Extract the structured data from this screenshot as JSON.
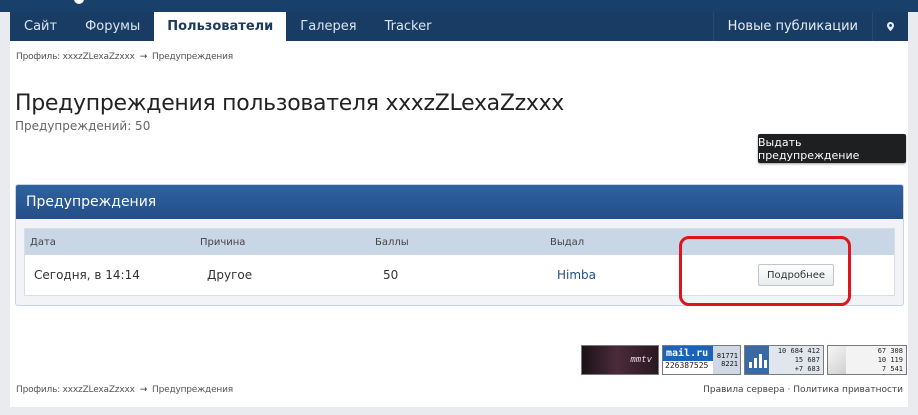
{
  "nav": {
    "tabs": [
      {
        "label": "Сайт"
      },
      {
        "label": "Форумы"
      },
      {
        "label": "Пользователи"
      },
      {
        "label": "Галерея"
      },
      {
        "label": "Tracker"
      }
    ],
    "active_index": 2,
    "new_posts": "Новые публикации",
    "pin_icon": "map-marker-icon"
  },
  "breadcrumb": {
    "profile": "Профиль: xxxzZLexaZzxxx",
    "arrow": "→",
    "current": "Предупреждения"
  },
  "page": {
    "title": "Предупреждения пользователя xxxzZLexaZzxxx",
    "count_text": "Предупреждений: 50",
    "issue_button": "Выдать предупреждение"
  },
  "warnings": {
    "header": "Предупреждения",
    "columns": [
      "Дата",
      "Причина",
      "Баллы",
      "Выдал"
    ],
    "rows": [
      {
        "date": "Сегодня, в 14:14",
        "reason": "Другое",
        "points": "50",
        "issued_by": "Himba",
        "details_button": "Подробнее"
      }
    ]
  },
  "counters": {
    "mmtv": "mmtv",
    "mail": {
      "brand": "mail.ru",
      "id": "226387525",
      "a": "81771",
      "b": "8221"
    },
    "hotlog": {
      "l1": "10 684 412",
      "l2": "15 687",
      "l3": "+7 683"
    },
    "liveinternet": {
      "l1": "67 308",
      "l2": "10 119",
      "l3": "7 541"
    }
  },
  "footer": {
    "rules": "Правила сервера",
    "sep": "·",
    "privacy": "Политика приватности"
  },
  "colors": {
    "nav_bg": "#183c64",
    "header_blue": "#2f62a0",
    "highlight_red": "#e0141c",
    "button_dark": "#1e1f21"
  }
}
